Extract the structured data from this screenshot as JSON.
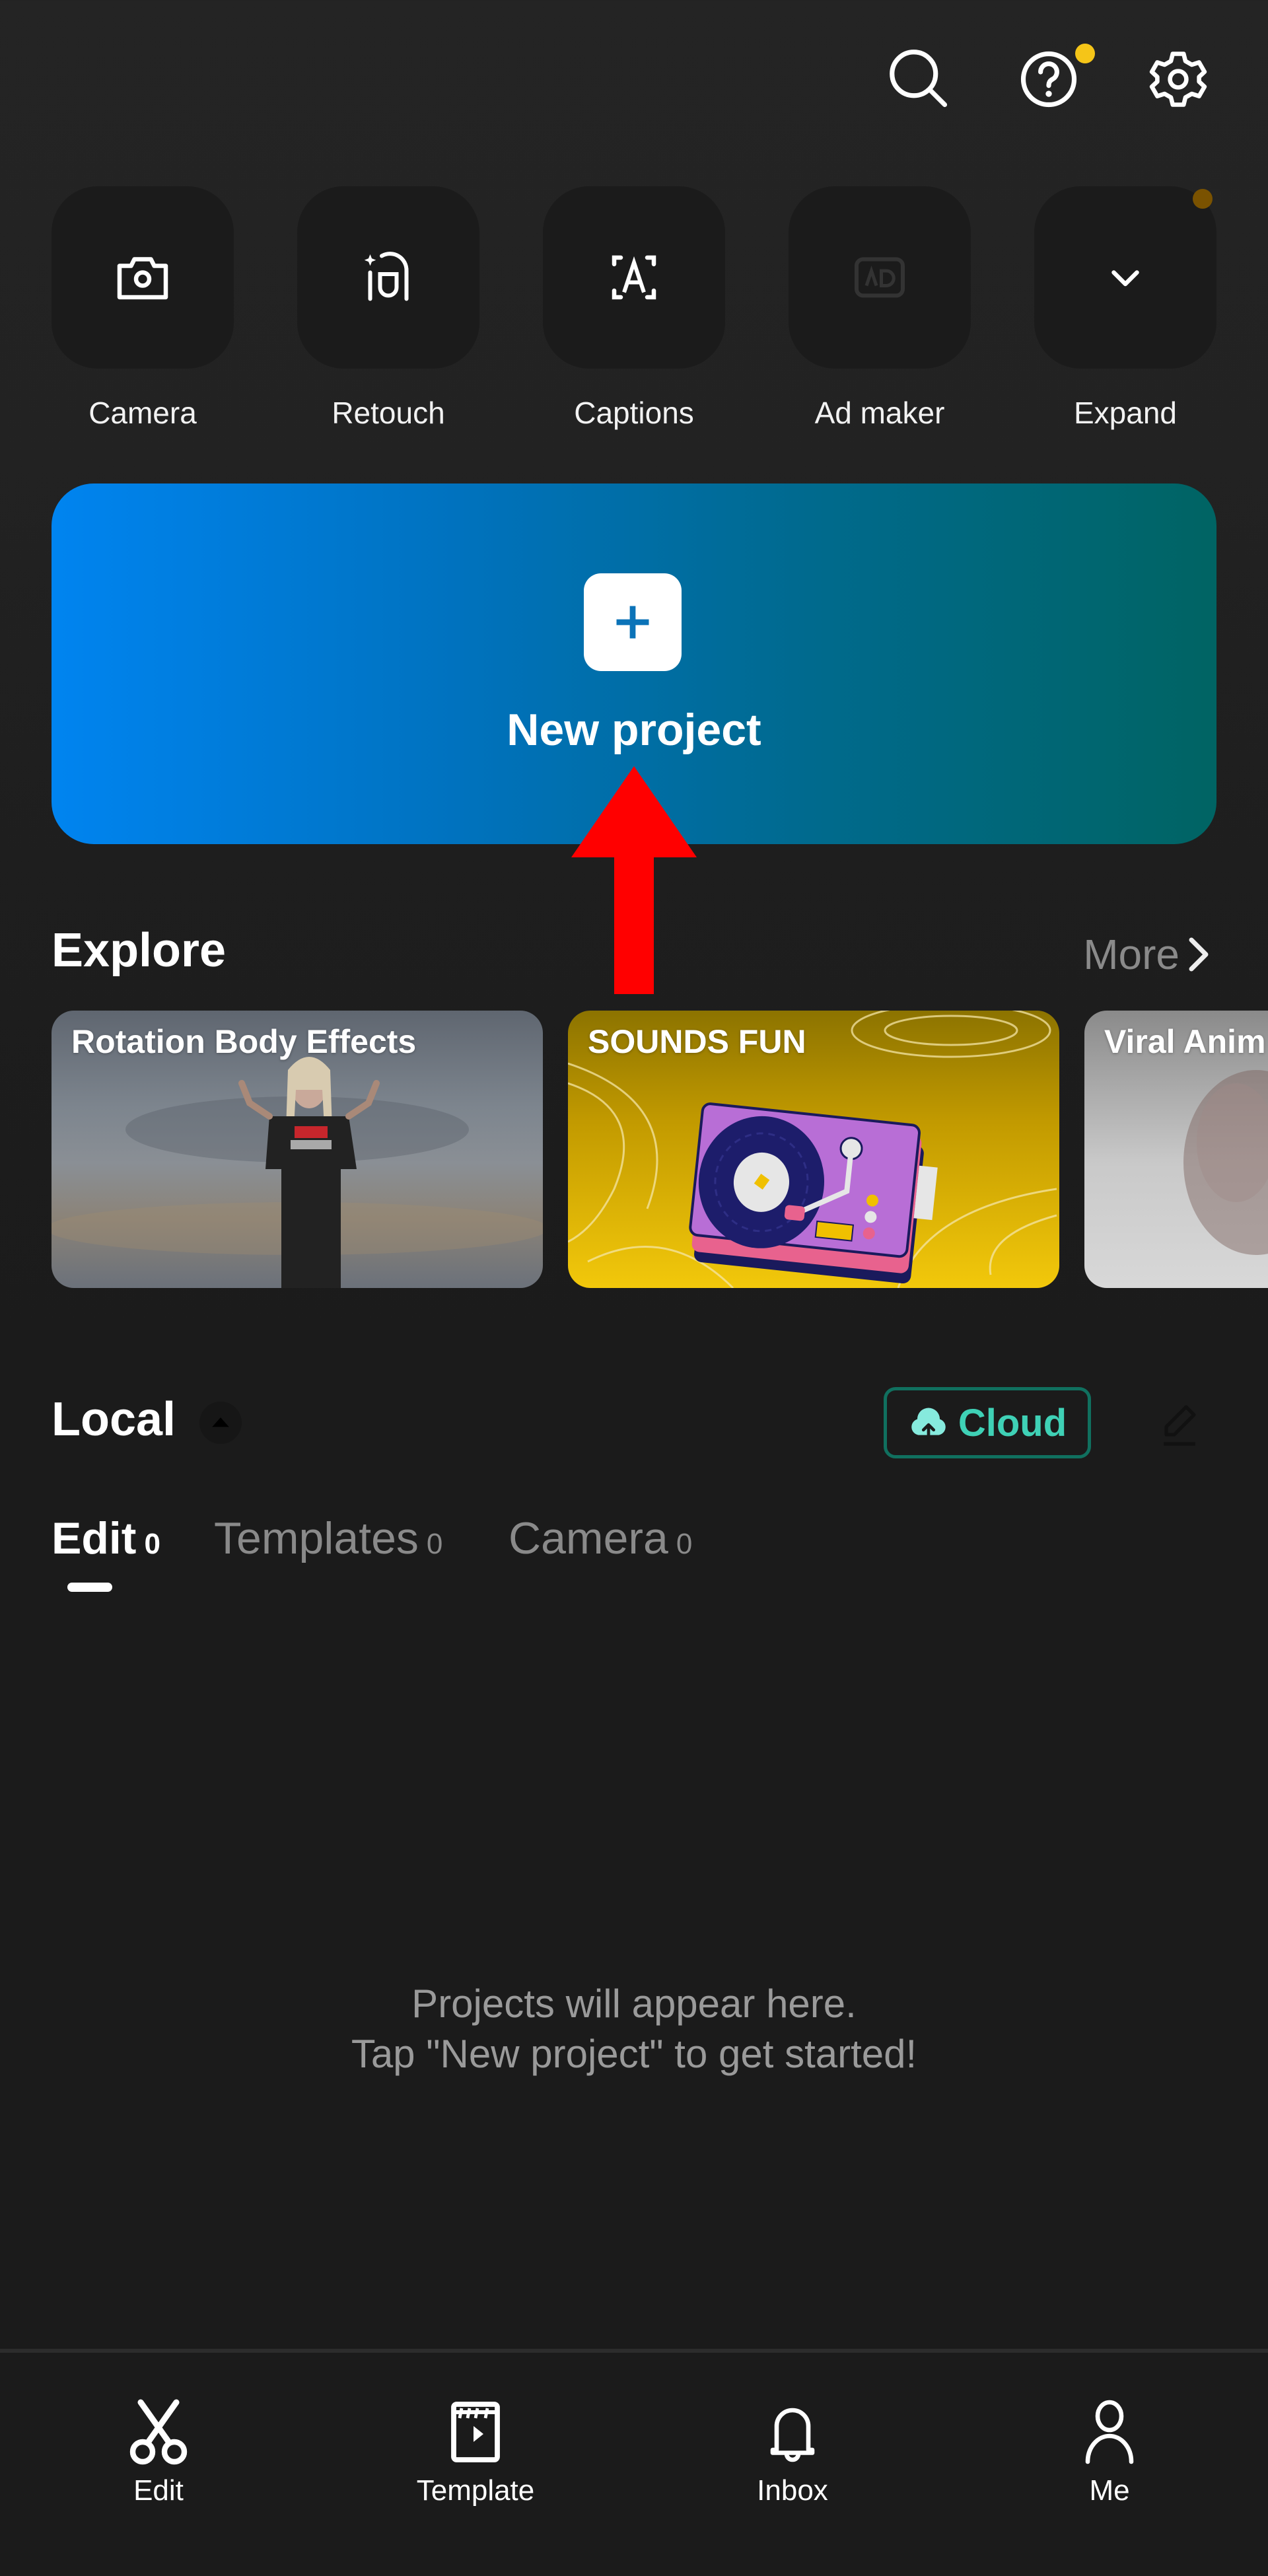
{
  "header": {
    "icons": [
      {
        "name": "search-icon"
      },
      {
        "name": "help-icon",
        "badge": true
      },
      {
        "name": "settings-icon"
      }
    ]
  },
  "quick_tools": [
    {
      "label": "Camera",
      "icon": "camera-icon",
      "enabled": true
    },
    {
      "label": "Retouch",
      "icon": "retouch-icon",
      "enabled": true
    },
    {
      "label": "Captions",
      "icon": "captions-icon",
      "enabled": true
    },
    {
      "label": "Ad maker",
      "icon": "ad-maker-icon",
      "enabled": false
    },
    {
      "label": "Expand",
      "icon": "chevron-down-icon",
      "enabled": true,
      "badge": true
    }
  ],
  "new_project": {
    "label": "New project",
    "icon": "plus-icon"
  },
  "explore": {
    "title": "Explore",
    "more_label": "More",
    "cards": [
      {
        "title": "Rotation Body Effects"
      },
      {
        "title": "SOUNDS FUN"
      },
      {
        "title": "Viral Anim"
      }
    ]
  },
  "local": {
    "title": "Local",
    "cloud_label": "Cloud",
    "tabs": [
      {
        "label": "Edit",
        "count": "0",
        "active": true
      },
      {
        "label": "Templates",
        "count": "0",
        "active": false
      },
      {
        "label": "Camera",
        "count": "0",
        "active": false
      }
    ],
    "empty_line1": "Projects will appear here.",
    "empty_line2": "Tap \"New project\" to get started!"
  },
  "bottom_nav": [
    {
      "label": "Edit",
      "icon": "scissors-icon",
      "active": true
    },
    {
      "label": "Template",
      "icon": "template-icon",
      "active": false
    },
    {
      "label": "Inbox",
      "icon": "bell-icon",
      "active": false
    },
    {
      "label": "Me",
      "icon": "user-icon",
      "active": false
    }
  ],
  "colors": {
    "accent_cloud": "#3fd1b6",
    "badge_yellow": "#f5c518",
    "annotation_red": "#ff0000"
  }
}
